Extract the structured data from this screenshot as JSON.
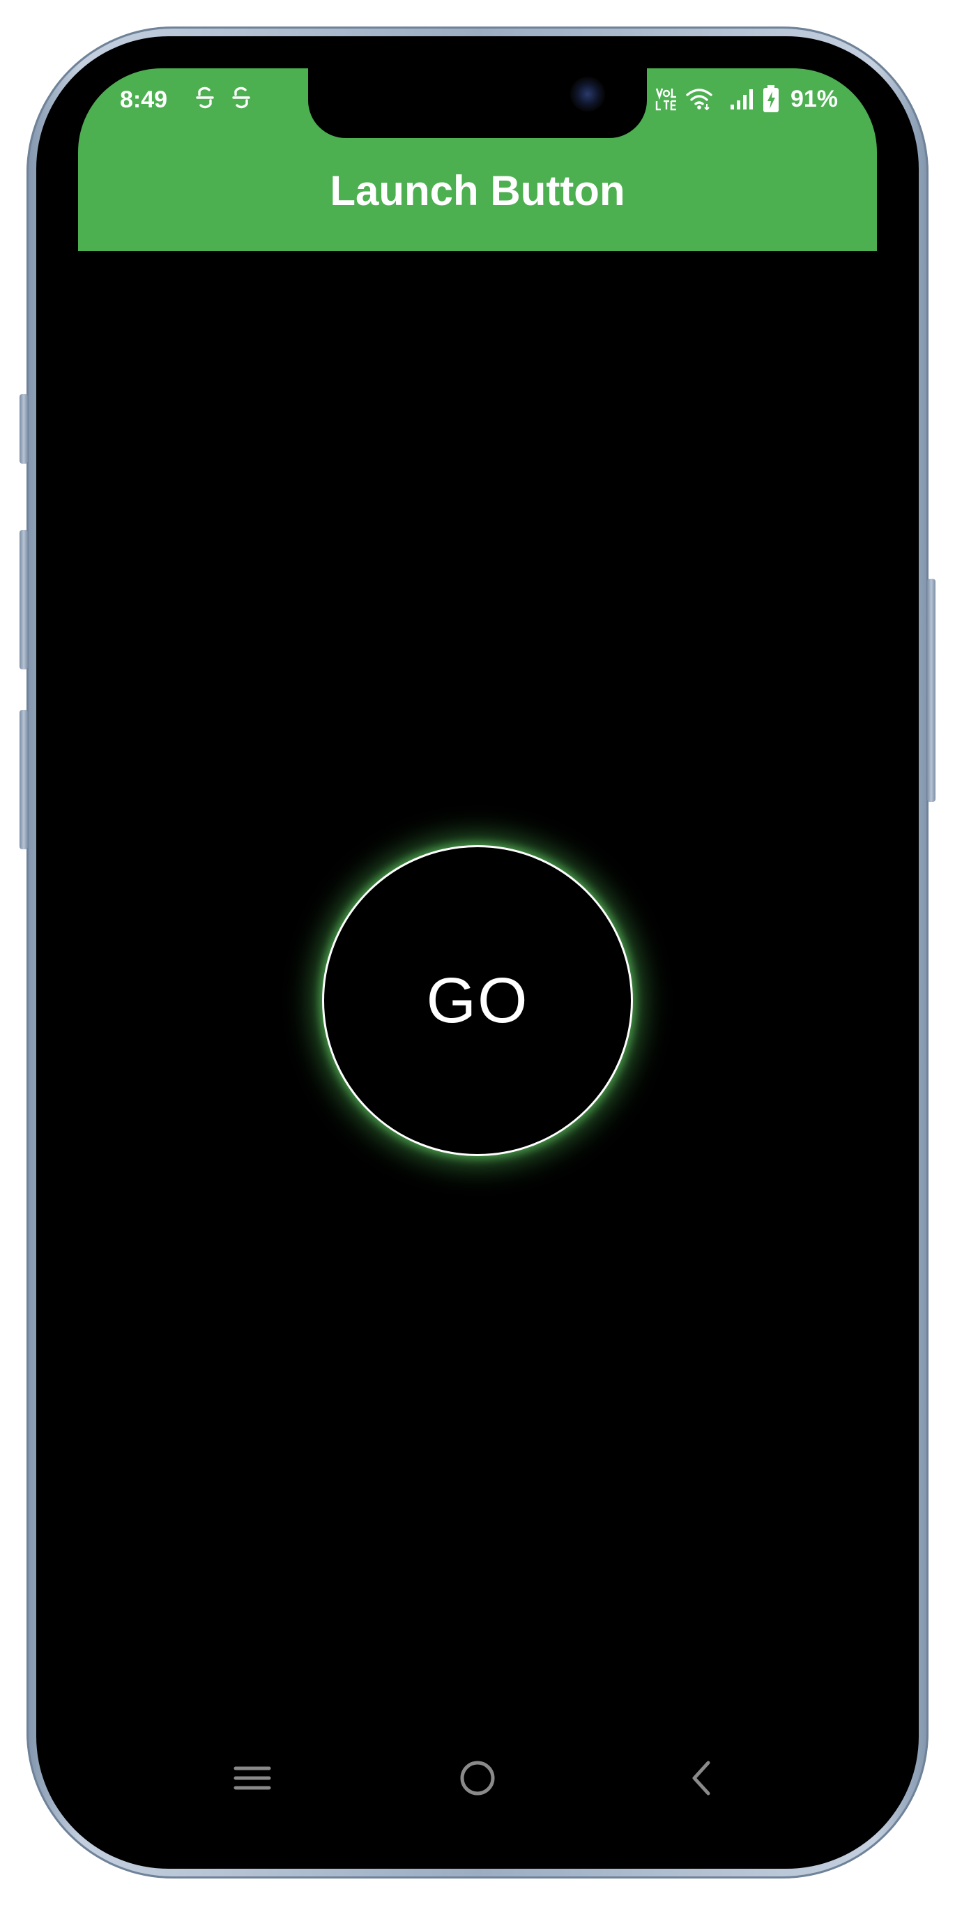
{
  "status_bar": {
    "time": "8:49",
    "left_icons": [
      "sim-sync-icon",
      "sim-sync-icon"
    ],
    "right_icons": [
      "volte-lte-icon",
      "wifi-icon",
      "signal-icon",
      "battery-charging-icon"
    ],
    "battery_percent": "91%"
  },
  "app_bar": {
    "title": "Launch Button",
    "background_color": "#4caf50"
  },
  "main": {
    "launch_button_label": "GO",
    "glow_color": "#4caf50",
    "background_color": "#000000"
  },
  "nav_bar": {
    "items": [
      "recent-apps-icon",
      "home-icon",
      "back-icon"
    ],
    "icon_color": "#8a8a8a"
  }
}
